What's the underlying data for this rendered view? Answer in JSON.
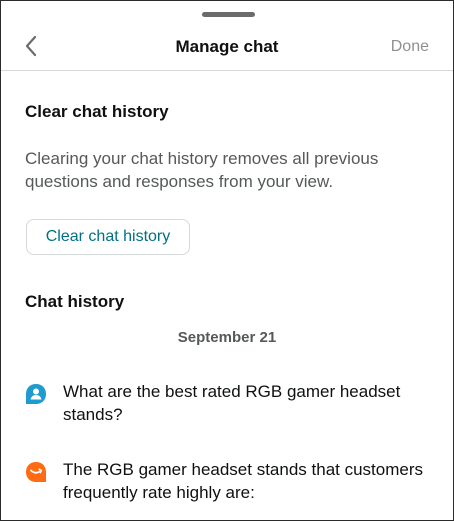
{
  "header": {
    "title": "Manage chat",
    "done_label": "Done",
    "back_icon": "chevron-left-icon"
  },
  "clear_section": {
    "title": "Clear chat history",
    "description": "Clearing your chat history removes all previous questions and responses from your view.",
    "button_label": "Clear chat history"
  },
  "history": {
    "title": "Chat history",
    "date": "September 21",
    "messages": [
      {
        "sender": "user",
        "icon": "user-avatar-icon",
        "icon_color": "#1f9bd0",
        "text": "What are the best rated RGB gamer headset stands?"
      },
      {
        "sender": "assistant",
        "icon": "assistant-smile-icon",
        "icon_color": "#ff6a13",
        "text": "The RGB gamer headset stands that customers frequently rate highly are:"
      }
    ]
  },
  "colors": {
    "link": "#007185",
    "muted": "#565959",
    "done_disabled": "#8e9191"
  }
}
